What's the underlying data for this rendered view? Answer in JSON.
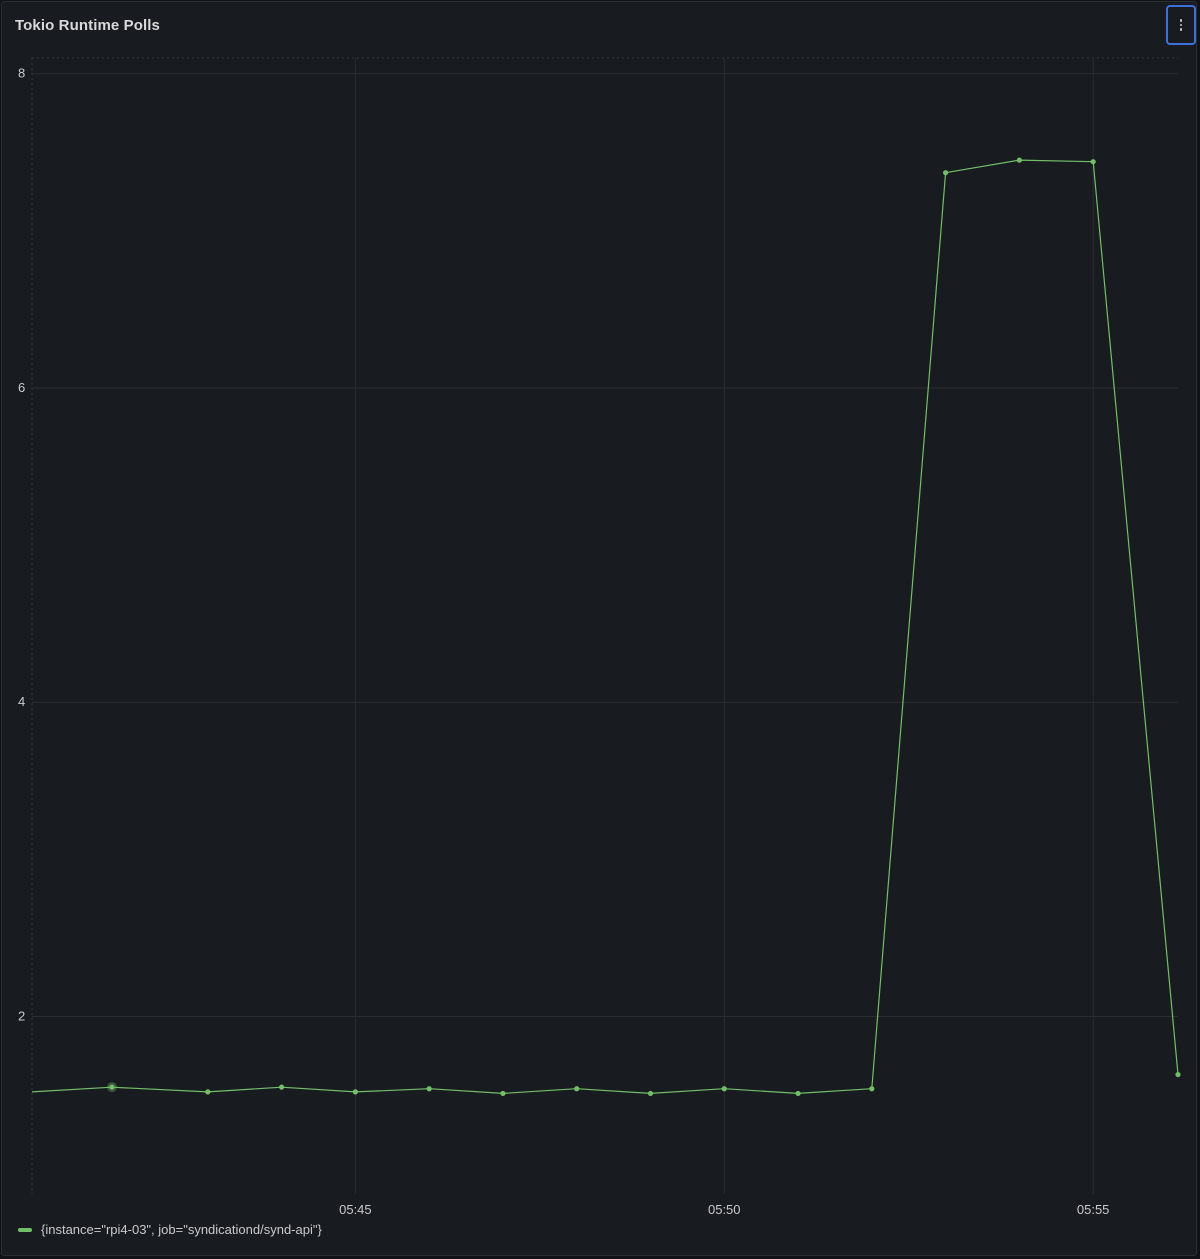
{
  "panel": {
    "title": "Tokio Runtime Polls",
    "menu_icon": "vertical-ellipsis-icon"
  },
  "legend": {
    "label": "{instance=\"rpi4-03\", job=\"syndicationd/synd-api\"}",
    "color": "#73bf69"
  },
  "colors": {
    "series": "#73bf69",
    "background": "#181b1f",
    "grid": "#2a2d33",
    "focus_border": "#3d71d9"
  },
  "chart_data": {
    "type": "line",
    "title": "Tokio Runtime Polls",
    "xlabel": "",
    "ylabel": "",
    "x_ticks": [
      "05:45",
      "05:50",
      "05:55"
    ],
    "y_ticks": [
      "2",
      "4",
      "6",
      "8"
    ],
    "xlim": [
      "05:40:37",
      "05:56:09"
    ],
    "ylim": [
      0.87,
      8.1
    ],
    "grid": true,
    "legend_position": "bottom-left",
    "series": [
      {
        "name": "{instance=\"rpi4-03\", job=\"syndicationd/synd-api\"}",
        "color": "#73bf69",
        "x": [
          "05:40:37",
          "05:41:42",
          "05:43:00",
          "05:44:00",
          "05:45:00",
          "05:46:00",
          "05:47:00",
          "05:48:00",
          "05:49:00",
          "05:50:00",
          "05:51:00",
          "05:52:00",
          "05:53:00",
          "05:54:00",
          "05:55:00",
          "05:56:09"
        ],
        "y": [
          1.52,
          1.55,
          1.52,
          1.55,
          1.52,
          1.54,
          1.51,
          1.54,
          1.51,
          1.54,
          1.51,
          1.54,
          7.37,
          7.45,
          7.44,
          1.63
        ]
      }
    ]
  }
}
